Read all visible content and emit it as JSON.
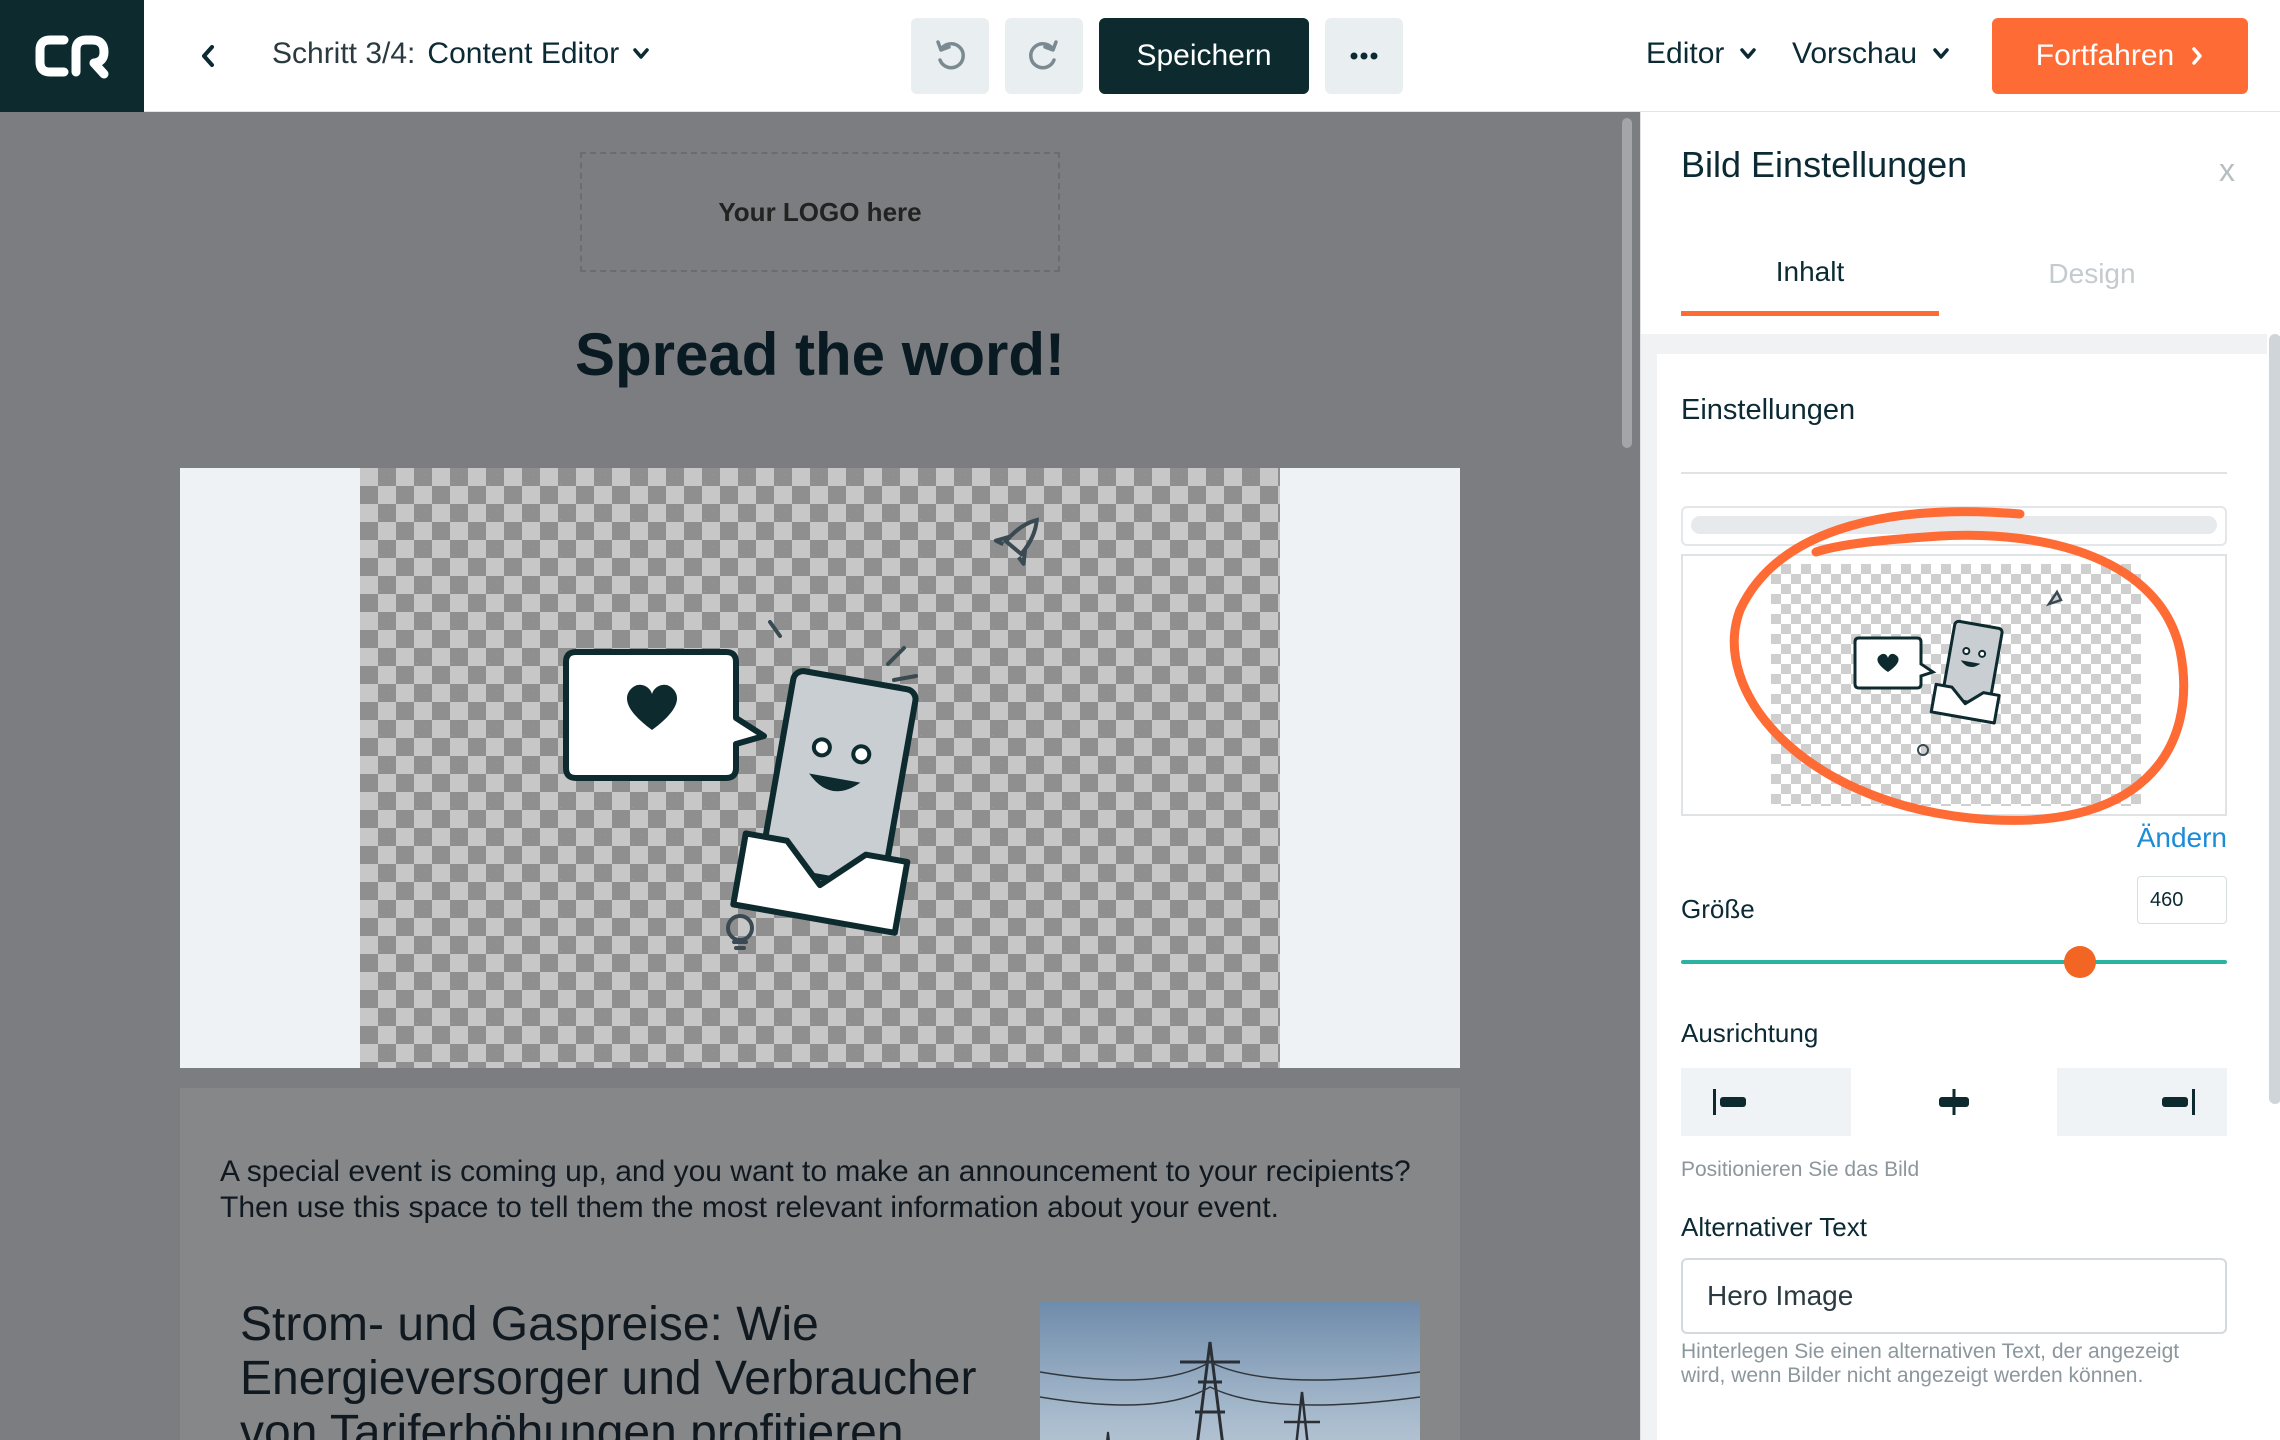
{
  "topbar": {
    "step_prefix": "Schritt 3/4:",
    "step_title": "Content Editor",
    "save_label": "Speichern",
    "editor_label": "Editor",
    "preview_label": "Vorschau",
    "continue_label": "Fortfahren"
  },
  "canvas": {
    "logo_placeholder": "Your LOGO here",
    "headline": "Spread the word!",
    "body_text": "A special event is coming up, and you want to make an announcement to your recipients? Then use this space to tell them the most relevant information about your event.",
    "article_title": "Strom- und Gaspreise: Wie Energieversorger und Verbraucher von Tariferhöhungen profitieren"
  },
  "panel": {
    "title": "Bild Einstellungen",
    "close_label": "x",
    "tab_content": "Inhalt",
    "tab_design": "Design",
    "section_title": "Einstellungen",
    "change_link": "Ändern",
    "size_label": "Größe",
    "size_value": "460",
    "size_fraction": 0.73,
    "align_label": "Ausrichtung",
    "align_help": "Positionieren Sie das Bild",
    "alt_label": "Alternativer Text",
    "alt_value": "Hero Image",
    "alt_help": "Hinterlegen Sie einen alternativen Text, der angezeigt wird, wenn Bilder nicht angezeigt werden können."
  },
  "colors": {
    "brand_dark": "#0d2b2e",
    "accent_orange": "#ff6b35",
    "slider_teal": "#2ab3a3",
    "link_blue": "#1a8cd8"
  },
  "icons": [
    "cr-logo-icon",
    "chevron-left-icon",
    "chevron-down-icon",
    "undo-icon",
    "redo-icon",
    "more-icon",
    "chevron-right-icon",
    "align-left-icon",
    "align-center-icon",
    "align-right-icon"
  ]
}
